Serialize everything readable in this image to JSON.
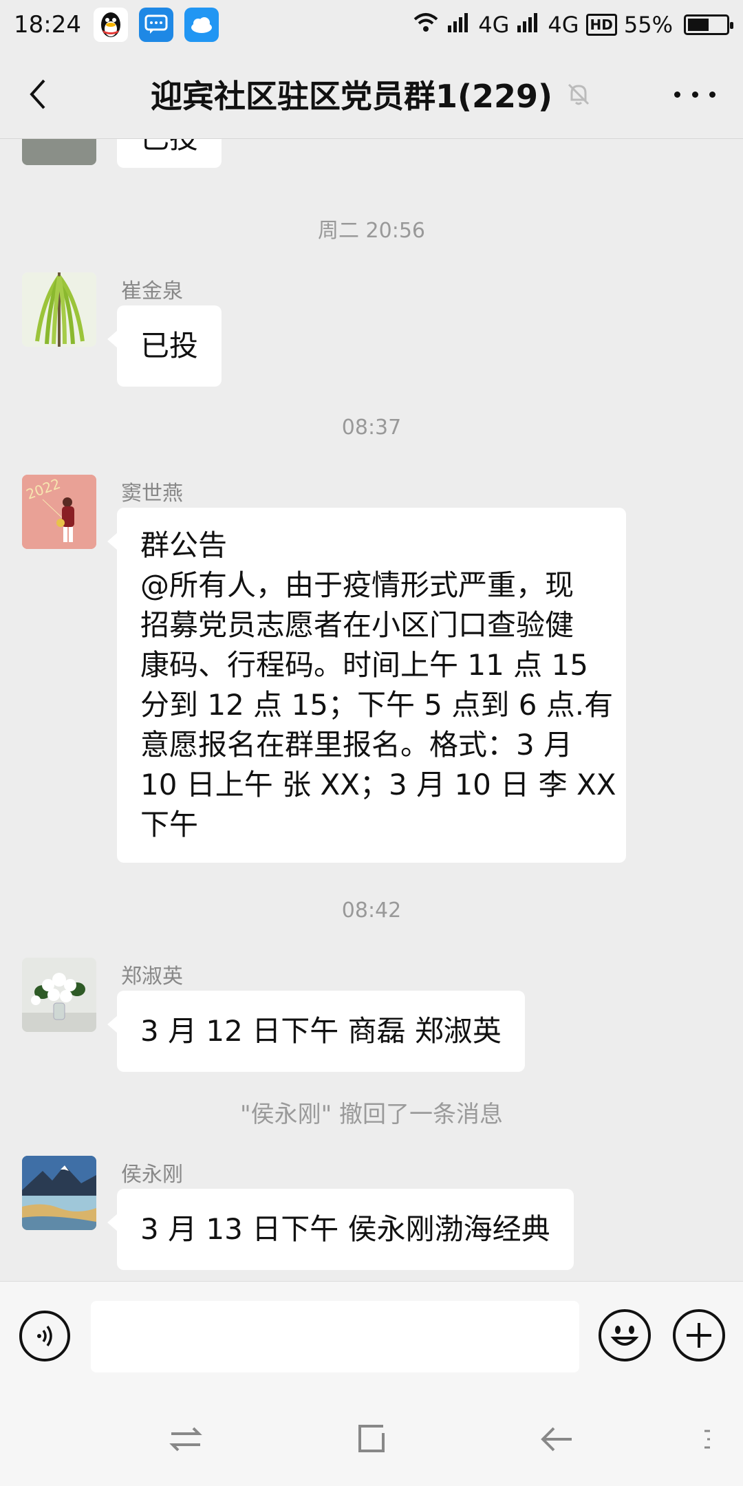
{
  "status_bar": {
    "time": "18:24",
    "network1": "4G",
    "network2": "4G",
    "hd": "HD",
    "battery_text": "55%",
    "battery_level": 0.55
  },
  "header": {
    "title": "迎宾社区驻区党员群1(229)"
  },
  "messages": {
    "partial": {
      "text": "已投"
    },
    "time1": "周二 20:56",
    "msg1": {
      "sender": "崔金泉",
      "text": "已投"
    },
    "time2": "08:37",
    "msg2": {
      "sender": "窦世燕",
      "lines": [
        "群公告",
        "@所有人，由于疫情形式严重，现",
        "招募党员志愿者在小区门口查验健",
        "康码、行程码。时间上午 11 点 15",
        "分到 12 点 15；下午 5 点到 6 点.有",
        "意愿报名在群里报名。格式：3 月",
        "10 日上午 张 XX；3 月 10 日 李 XX",
        "下午"
      ]
    },
    "time3": "08:42",
    "msg3": {
      "sender": "郑淑英",
      "text": "3 月 12 日下午 商磊 郑淑英"
    },
    "recall_note": "\"侯永刚\" 撤回了一条消息",
    "msg4": {
      "sender": "侯永刚",
      "text": "3 月 13 日下午 侯永刚渤海经典"
    }
  },
  "input": {
    "placeholder": ""
  },
  "colors": {
    "background": "#ededed",
    "bubble": "#ffffff",
    "timestamp": "#999999"
  }
}
